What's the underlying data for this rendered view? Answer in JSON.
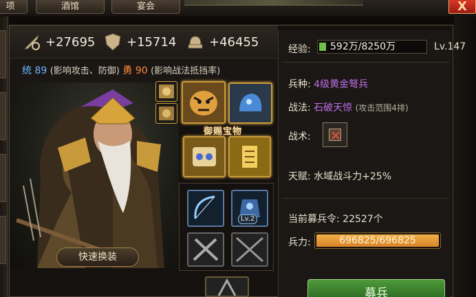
{
  "tabs": [
    "项",
    "酒馆",
    "宴会"
  ],
  "close_label": "X",
  "stats": {
    "attack": "+27695",
    "defense": "+15714",
    "troops": "+46455"
  },
  "attributes": {
    "lead_label": "统",
    "lead_value": "89",
    "lead_note": "(影响攻击、防御)",
    "brave_label": "勇",
    "brave_value": "90",
    "brave_note": "(影响战法抵挡率)"
  },
  "treasure_label": "御赐宝物",
  "swap_label": "快速换装",
  "item_badge": "Lv.2",
  "info": {
    "exp_label": "经验:",
    "exp_value": "592万/8250万",
    "exp_progress": 0.072,
    "level": "Lv.147",
    "troop_type_label": "兵种:",
    "troop_type_value": "4级黄金弩兵",
    "tactic_label": "战法:",
    "tactic_value": "石破天惊",
    "tactic_note": "(攻击范围4排)",
    "skill_label": "战术:",
    "talent_label": "天赋:",
    "talent_value": "水域战斗力+25%",
    "recruit_tokens_label": "当前募兵令:",
    "recruit_tokens_value": "22527个",
    "troop_label": "兵力:",
    "troop_value": "696825/696825",
    "troop_progress": 1.0,
    "recruit_button": "募兵"
  },
  "colors": {
    "accent_purple": "#c06ee8",
    "lead_blue": "#6bb8ff",
    "brave_orange": "#ff8a3d",
    "recruit_green": "#4e9a3a",
    "troop_bar": "#e89a3a"
  }
}
